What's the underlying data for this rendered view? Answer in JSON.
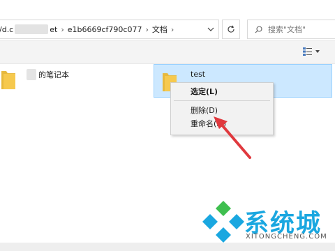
{
  "address_bar": {
    "path_start": "/d.c",
    "path_mid": "et",
    "folder_id": "e1b6669cf790c077",
    "current_folder": "文档"
  },
  "search": {
    "placeholder": "搜索\"文档\""
  },
  "items": [
    {
      "name": "的笔记本"
    },
    {
      "name": "test"
    }
  ],
  "context_menu": {
    "items": [
      "选定(L)",
      "删除(D)",
      "重命名(M)"
    ]
  },
  "watermark": {
    "cn": "系统城",
    "en": "XITONGCHENG.COM"
  },
  "colors": {
    "selection_bg": "#cce8ff",
    "selection_border": "#99d1ff",
    "folder_yellow": "#f6c94e",
    "arrow_red": "#e0393e",
    "brand_blue": "#1aa7e0"
  }
}
